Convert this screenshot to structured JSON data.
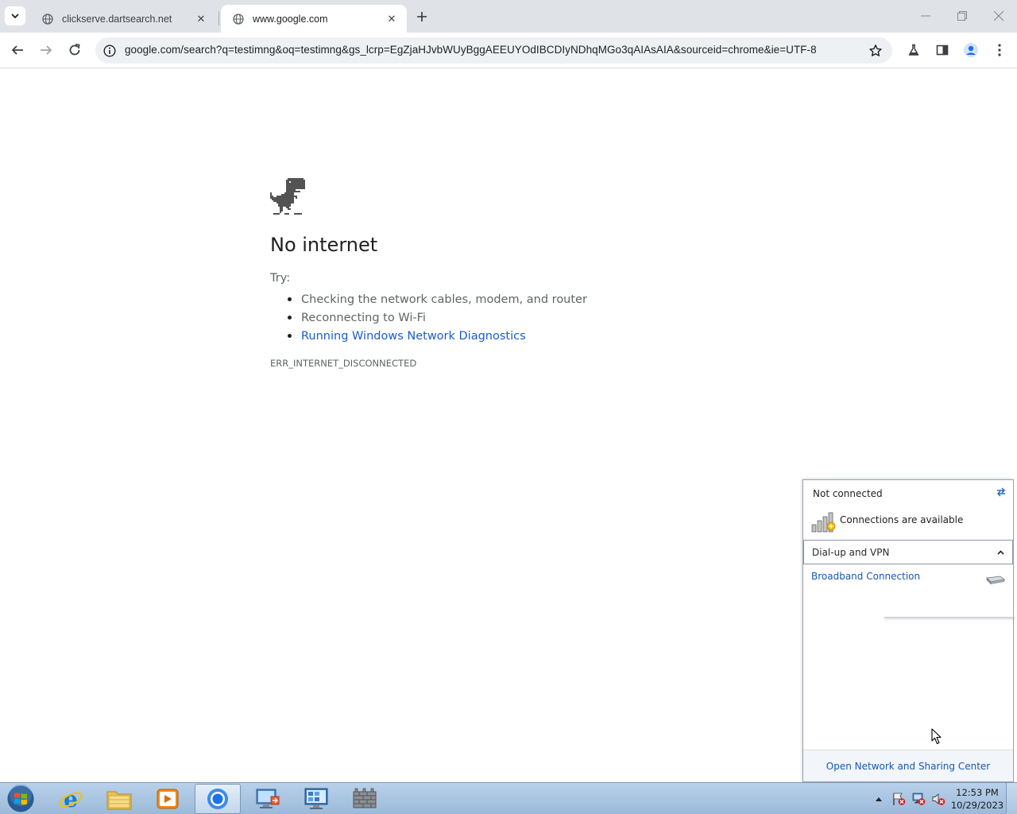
{
  "browser": {
    "tabs": [
      {
        "title": "clickserve.dartsearch.net",
        "active": false
      },
      {
        "title": "www.google.com",
        "active": true
      }
    ],
    "url": "google.com/search?q=testimng&oq=testimng&gs_lcrp=EgZjaHJvbWUyBggAEEUYOdIBCDIyNDhqMGo3qAIAsAIA&sourceid=chrome&ie=UTF-8"
  },
  "error_page": {
    "title": "No internet",
    "try_label": "Try:",
    "suggestions": [
      "Checking the network cables, modem, and router",
      "Reconnecting to Wi-Fi",
      "Running Windows Network Diagnostics"
    ],
    "error_code": "ERR_INTERNET_DISCONNECTED"
  },
  "network_flyout": {
    "status": "Not connected",
    "availability": "Connections are available",
    "section_label": "Dial-up and VPN",
    "connection_name": "Broadband Connection",
    "footer_link": "Open Network and Sharing Center"
  },
  "taskbar": {
    "time": "12:53 PM",
    "date": "10/29/2023",
    "apps": [
      "internet-explorer-icon",
      "file-explorer-icon",
      "media-player-icon",
      "chrome-icon",
      "remote-desktop-icon",
      "control-panel-icon",
      "firewall-icon"
    ],
    "active_app": "chrome-icon"
  },
  "colors": {
    "link": "#1a5dcc",
    "flyout_link": "#1559b3",
    "tabstrip": "#dfe3e8",
    "omnibox": "#eef1f4",
    "account_accent": "#1a73e8"
  }
}
